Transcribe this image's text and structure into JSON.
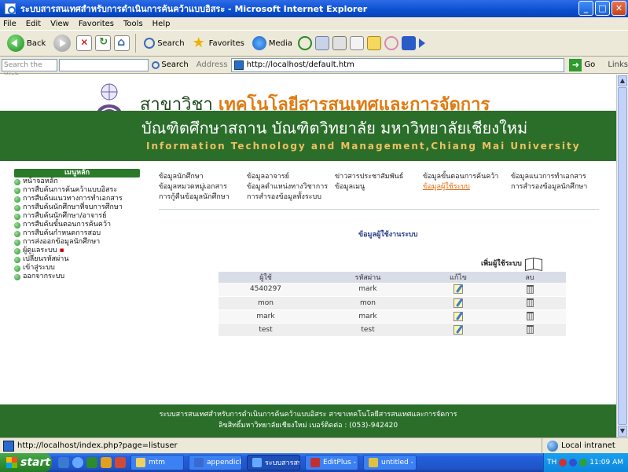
{
  "window": {
    "title": "ระบบสารสนเทศสำหรับการดำเนินการค้นคว้าแบบอิสระ - Microsoft Internet Explorer",
    "buttons": [
      "_",
      "□",
      "✕"
    ]
  },
  "menubar": [
    "File",
    "Edit",
    "View",
    "Favorites",
    "Tools",
    "Help"
  ],
  "toolbar": {
    "back_label": "Back",
    "search_label": "Search",
    "favorites_label": "Favorites",
    "media_label": "Media"
  },
  "addressbar": {
    "search_web_placeholder": "Search the Web",
    "search_button": "Search",
    "address_label": "Address",
    "url": "http://localhost/default.htm",
    "go_label": "Go",
    "links_label": "Links"
  },
  "banner": {
    "line1_prefix": "สาขาวิชา",
    "line1_highlight": "เทคโนโลยีสารสนเทศและการจัดการ",
    "line2": "บัณฑิตศึกษาสถาน บัณฑิตวิทยาลัย  มหาวิทยาลัยเชียงใหม่",
    "line3": "Information Technology and Management,Chiang Mai University"
  },
  "leftnav": {
    "heading": "เมนูหลัก",
    "items": [
      "หน้าจอหลัก",
      "การสืบค้นการค้นคว้าแบบอิสระ",
      "การสืบค้นแนวทางการทำเอกสาร",
      "การสืบค้นนักศึกษาที่จบการศึกษา",
      "การสืบค้นนักศึกษา/อาจารย์",
      "การสืบค้นขั้นตอนการค้นคว้า",
      "การสืบค้นกำหนดการสอบ",
      "การส่งออกข้อมูลนักศึกษา",
      "ผู้ดูแลระบบ",
      "เปลี่ยนรหัสผ่าน",
      "เข้าสู่ระบบ",
      "ออกจากระบบ"
    ]
  },
  "topmenu": {
    "rows": [
      [
        "ข้อมูลนักศึกษา",
        "ข้อมูลอาจารย์",
        "ข่าวสารประชาสัมพันธ์",
        "ข้อมูลขั้นตอนการค้นคว้า",
        "ข้อมูลแนวการทำเอกสาร"
      ],
      [
        "ข้อมูลหมวดหมู่เอกสาร",
        "ข้อมูลตำแหน่งทางวิชาการ",
        "ข้อมูลเมนู",
        "ข้อมูลผู้ใช้ระบบ",
        "การสำรองข้อมูลนักศึกษา"
      ],
      [
        "การกู้คืนข้อมูลนักศึกษา",
        "การสำรองข้อมูลทั้งระบบ",
        "",
        "",
        ""
      ]
    ],
    "active": "ข้อมูลผู้ใช้ระบบ"
  },
  "section_title": "ข้อมูลผู้ใช้งานระบบ",
  "add_user_label": "เพิ่มผู้ใช้ระบบ",
  "usertable": {
    "headers": [
      "ผู้ใช้",
      "รหัสผ่าน",
      "แก้ไข",
      "ลบ"
    ],
    "rows": [
      {
        "user": "4540297",
        "password": "mark"
      },
      {
        "user": "mon",
        "password": "mon"
      },
      {
        "user": "mark",
        "password": "mark"
      },
      {
        "user": "test",
        "password": "test"
      }
    ]
  },
  "footer": {
    "line1": "ระบบสารสนเทศสำหรับการดำเนินการค้นคว้าแบบอิสระ สาขาเทคโนโลยีสารสนเทศและการจัดการ",
    "line2": "ลิขสิทธิ์มหาวิทยาลัยเชียงใหม่ เบอร์ติดต่อ : (053)-942420"
  },
  "statusbar": {
    "url": "http://localhost/index.php?page=listuser",
    "zone": "Local intranet"
  },
  "taskbar": {
    "start_label": "start",
    "tasks": [
      "mtm",
      "appendicII...",
      "ระบบสารสน...",
      "EditPlus - [...",
      "untitled - P..."
    ],
    "active_index": 2,
    "lang": "TH",
    "clock": "11:09 AM"
  },
  "colors": {
    "banner_green": "#2a6e2a",
    "highlight_orange": "#e07a12",
    "active_link": "#e06a0a"
  }
}
